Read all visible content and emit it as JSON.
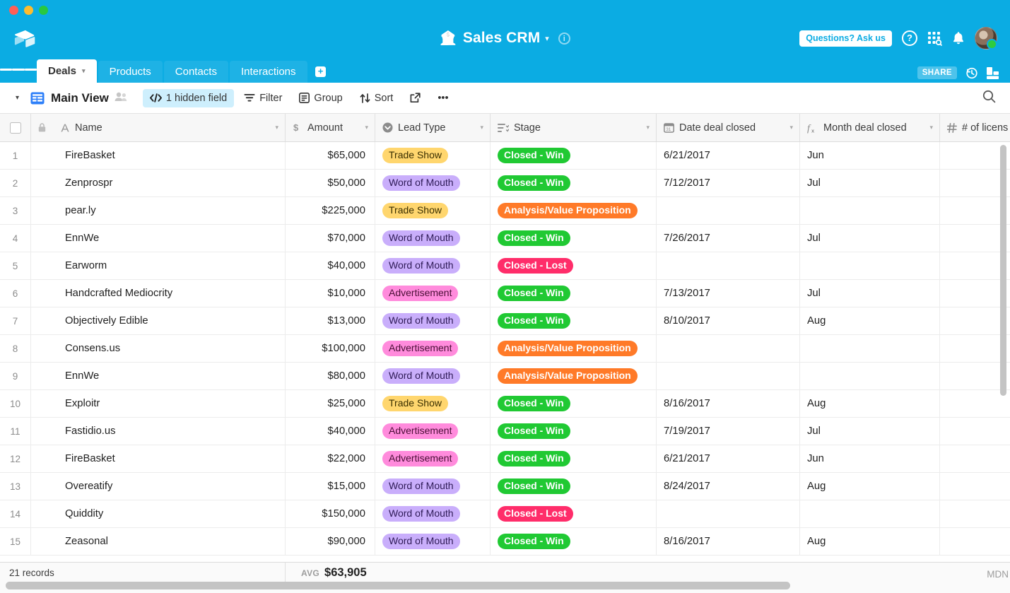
{
  "window": {
    "traffic_lights": [
      "close",
      "minimize",
      "zoom"
    ]
  },
  "header": {
    "base_icon": "money-bag-icon",
    "base_name": "Sales CRM",
    "base_caret": "▾",
    "info_label": "i",
    "ask_button": "Questions? Ask us",
    "help_label": "?",
    "apps_icon": "apps-search-icon",
    "bell_icon": "notifications-icon",
    "avatar_icon": "user-avatar"
  },
  "tabs": {
    "items": [
      {
        "label": "Deals",
        "active": true,
        "caret": "▾"
      },
      {
        "label": "Products",
        "active": false
      },
      {
        "label": "Contacts",
        "active": false
      },
      {
        "label": "Interactions",
        "active": false
      }
    ],
    "add_label": "+",
    "share_label": "SHARE",
    "history_icon": "history-clock-icon",
    "apps_panel_icon": "blocks-icon",
    "menu_icon": "hamburger-menu-icon"
  },
  "viewbar": {
    "caret": "▾",
    "view_icon": "grid-view-icon",
    "view_name": "Main View",
    "collaborators_icon": "collaborators-icon",
    "hidden_fields": "1 hidden field",
    "filter": "Filter",
    "group": "Group",
    "sort": "Sort",
    "share_view_icon": "share-view-icon",
    "more": "•••",
    "search_icon": "search-icon"
  },
  "grid": {
    "columns": [
      {
        "key": "rownum",
        "label": "",
        "icon": "checkbox-icon",
        "type": "rownum"
      },
      {
        "key": "name",
        "label": "Name",
        "icon": "text-field-icon",
        "type": "text"
      },
      {
        "key": "amount",
        "label": "Amount",
        "icon": "currency-icon",
        "type": "currency"
      },
      {
        "key": "lead",
        "label": "Lead Type",
        "icon": "single-select-icon",
        "type": "select"
      },
      {
        "key": "stage",
        "label": "Stage",
        "icon": "multi-select-icon",
        "type": "select"
      },
      {
        "key": "date",
        "label": "Date deal closed",
        "icon": "calendar-icon",
        "type": "date"
      },
      {
        "key": "month",
        "label": "Month deal closed",
        "icon": "formula-icon",
        "type": "formula"
      },
      {
        "key": "lic",
        "label": "# of licens",
        "icon": "number-icon",
        "type": "number"
      }
    ],
    "rows": [
      {
        "n": "1",
        "name": "FireBasket",
        "amount": "$65,000",
        "lead": "Trade Show",
        "lead_class": "trade",
        "stage": "Closed - Win",
        "stage_class": "win",
        "date": "6/21/2017",
        "month": "Jun",
        "lic": ""
      },
      {
        "n": "2",
        "name": "Zenprospr",
        "amount": "$50,000",
        "lead": "Word of Mouth",
        "lead_class": "word",
        "stage": "Closed - Win",
        "stage_class": "win",
        "date": "7/12/2017",
        "month": "Jul",
        "lic": ""
      },
      {
        "n": "3",
        "name": "pear.ly",
        "amount": "$225,000",
        "lead": "Trade Show",
        "lead_class": "trade",
        "stage": "Analysis/Value Proposition",
        "stage_class": "anal",
        "date": "",
        "month": "",
        "lic": ""
      },
      {
        "n": "4",
        "name": "EnnWe",
        "amount": "$70,000",
        "lead": "Word of Mouth",
        "lead_class": "word",
        "stage": "Closed - Win",
        "stage_class": "win",
        "date": "7/26/2017",
        "month": "Jul",
        "lic": ""
      },
      {
        "n": "5",
        "name": "Earworm",
        "amount": "$40,000",
        "lead": "Word of Mouth",
        "lead_class": "word",
        "stage": "Closed - Lost",
        "stage_class": "lost",
        "date": "",
        "month": "",
        "lic": ""
      },
      {
        "n": "6",
        "name": "Handcrafted Mediocrity",
        "amount": "$10,000",
        "lead": "Advertisement",
        "lead_class": "ad",
        "stage": "Closed - Win",
        "stage_class": "win",
        "date": "7/13/2017",
        "month": "Jul",
        "lic": ""
      },
      {
        "n": "7",
        "name": "Objectively Edible",
        "amount": "$13,000",
        "lead": "Word of Mouth",
        "lead_class": "word",
        "stage": "Closed - Win",
        "stage_class": "win",
        "date": "8/10/2017",
        "month": "Aug",
        "lic": ""
      },
      {
        "n": "8",
        "name": "Consens.us",
        "amount": "$100,000",
        "lead": "Advertisement",
        "lead_class": "ad",
        "stage": "Analysis/Value Proposition",
        "stage_class": "anal",
        "date": "",
        "month": "",
        "lic": ""
      },
      {
        "n": "9",
        "name": "EnnWe",
        "amount": "$80,000",
        "lead": "Word of Mouth",
        "lead_class": "word",
        "stage": "Analysis/Value Proposition",
        "stage_class": "anal",
        "date": "",
        "month": "",
        "lic": ""
      },
      {
        "n": "10",
        "name": "Exploitr",
        "amount": "$25,000",
        "lead": "Trade Show",
        "lead_class": "trade",
        "stage": "Closed - Win",
        "stage_class": "win",
        "date": "8/16/2017",
        "month": "Aug",
        "lic": ""
      },
      {
        "n": "11",
        "name": "Fastidio.us",
        "amount": "$40,000",
        "lead": "Advertisement",
        "lead_class": "ad",
        "stage": "Closed - Win",
        "stage_class": "win",
        "date": "7/19/2017",
        "month": "Jul",
        "lic": ""
      },
      {
        "n": "12",
        "name": "FireBasket",
        "amount": "$22,000",
        "lead": "Advertisement",
        "lead_class": "ad",
        "stage": "Closed - Win",
        "stage_class": "win",
        "date": "6/21/2017",
        "month": "Jun",
        "lic": ""
      },
      {
        "n": "13",
        "name": "Overeatify",
        "amount": "$15,000",
        "lead": "Word of Mouth",
        "lead_class": "word",
        "stage": "Closed - Win",
        "stage_class": "win",
        "date": "8/24/2017",
        "month": "Aug",
        "lic": ""
      },
      {
        "n": "14",
        "name": "Quiddity",
        "amount": "$150,000",
        "lead": "Word of Mouth",
        "lead_class": "word",
        "stage": "Closed - Lost",
        "stage_class": "lost",
        "date": "",
        "month": "",
        "lic": ""
      },
      {
        "n": "15",
        "name": "Zeasonal",
        "amount": "$90,000",
        "lead": "Word of Mouth",
        "lead_class": "word",
        "stage": "Closed - Win",
        "stage_class": "win",
        "date": "8/16/2017",
        "month": "Aug",
        "lic": ""
      }
    ]
  },
  "footer": {
    "records": "21 records",
    "avg_label": "AVG",
    "avg_value": "$63,905",
    "right_label": "MDN"
  },
  "colors": {
    "brand_blue": "#0BACE3",
    "chip_blue": "#CEEFFD",
    "win_green": "#20C933",
    "lost_pink": "#FF2D6A",
    "analysis_orange": "#FF7A28",
    "trade_yellow": "#FFD66E",
    "word_purple": "#C9AEFB",
    "ad_pink": "#FF8BDC"
  }
}
